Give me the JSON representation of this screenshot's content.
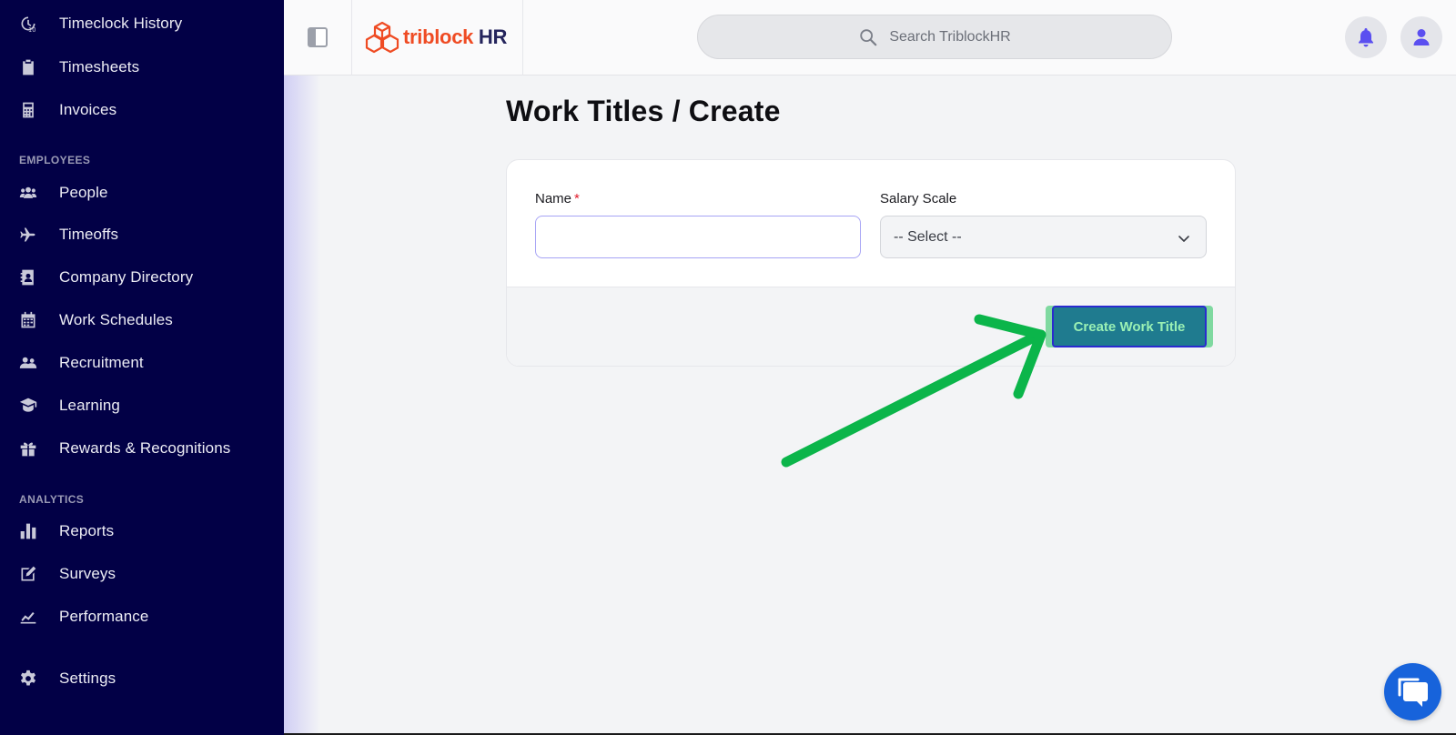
{
  "sidebar": {
    "items_top": [
      {
        "label": "Timeclock History",
        "icon": "clock-history-icon"
      },
      {
        "label": "Timesheets",
        "icon": "clipboard-icon"
      },
      {
        "label": "Invoices",
        "icon": "calculator-icon"
      }
    ],
    "sections": {
      "employees": "EMPLOYEES",
      "analytics": "ANALYTICS"
    },
    "items_employees": [
      {
        "label": "People",
        "icon": "users-icon"
      },
      {
        "label": "Timeoffs",
        "icon": "plane-icon"
      },
      {
        "label": "Company Directory",
        "icon": "address-book-icon"
      },
      {
        "label": "Work Schedules",
        "icon": "calendar-icon"
      },
      {
        "label": "Recruitment",
        "icon": "people-group-icon"
      },
      {
        "label": "Learning",
        "icon": "graduation-cap-icon"
      },
      {
        "label": "Rewards & Recognitions",
        "icon": "gift-icon"
      }
    ],
    "items_analytics": [
      {
        "label": "Reports",
        "icon": "bar-chart-icon"
      },
      {
        "label": "Surveys",
        "icon": "pen-square-icon"
      },
      {
        "label": "Performance",
        "icon": "trend-line-icon"
      }
    ],
    "settings": {
      "label": "Settings",
      "icon": "gear-icon"
    }
  },
  "header": {
    "logo_part1": "triblock",
    "logo_part2": "HR",
    "search_placeholder": "Search TriblockHR"
  },
  "main": {
    "title": "Work Titles / Create",
    "form": {
      "name_label": "Name",
      "name_required_mark": "*",
      "name_value": "",
      "salary_label": "Salary Scale",
      "salary_selected": "-- Select --",
      "submit_label": "Create Work Title"
    }
  },
  "colors": {
    "sidebar_bg": "#020046",
    "accent": "#5b4ff0",
    "brand_orange": "#ef4b23",
    "button_bg": "#1f7b8f",
    "annotation_arrow": "#0bb54a",
    "chat_button": "#1763db"
  }
}
